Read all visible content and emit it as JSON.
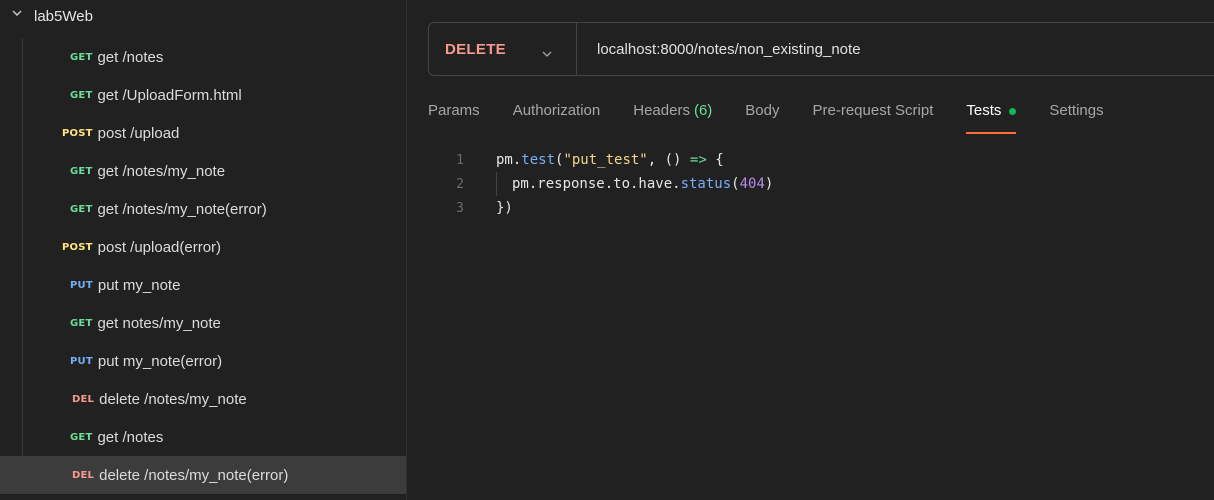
{
  "sidebar": {
    "folder": "lab5Web",
    "items": [
      {
        "method": "GET",
        "name": "get /notes",
        "cls": "m-get"
      },
      {
        "method": "GET",
        "name": "get /UploadForm.html",
        "cls": "m-get"
      },
      {
        "method": "POST",
        "name": "post /upload",
        "cls": "m-post"
      },
      {
        "method": "GET",
        "name": "get /notes/my_note",
        "cls": "m-get"
      },
      {
        "method": "GET",
        "name": "get /notes/my_note(error)",
        "cls": "m-get"
      },
      {
        "method": "POST",
        "name": "post /upload(error)",
        "cls": "m-post"
      },
      {
        "method": "PUT",
        "name": "put my_note",
        "cls": "m-put"
      },
      {
        "method": "GET",
        "name": "get notes/my_note",
        "cls": "m-get"
      },
      {
        "method": "PUT",
        "name": "put my_note(error)",
        "cls": "m-put"
      },
      {
        "method": "DEL",
        "name": "delete /notes/my_note",
        "cls": "m-del"
      },
      {
        "method": "GET",
        "name": "get /notes",
        "cls": "m-get"
      },
      {
        "method": "DEL",
        "name": "delete /notes/my_note(error)",
        "cls": "m-del"
      }
    ]
  },
  "request": {
    "method": "DELETE",
    "url": "localhost:8000/notes/non_existing_note"
  },
  "tabs": {
    "params": "Params",
    "authorization": "Authorization",
    "headers": "Headers",
    "headers_count": "(6)",
    "body": "Body",
    "prerequest": "Pre-request Script",
    "tests": "Tests",
    "settings": "Settings"
  },
  "editor": {
    "line_numbers": [
      "1",
      "2",
      "3"
    ],
    "line1": {
      "a": "pm.",
      "b": "test",
      "c": "(",
      "d": "\"put_test\"",
      "e": ", () ",
      "f": "=>",
      "g": " {"
    },
    "line2": {
      "a": "pm.response.to.have.",
      "b": "status",
      "c": "(",
      "d": "404",
      "e": ")"
    },
    "line3": {
      "a": "})"
    }
  },
  "colors": {
    "accent": "#ff6c37",
    "get": "#6bdd9a",
    "post": "#ffe47e",
    "put": "#74aef6",
    "delete": "#f79a8e",
    "status_dot": "#0cbb52"
  }
}
